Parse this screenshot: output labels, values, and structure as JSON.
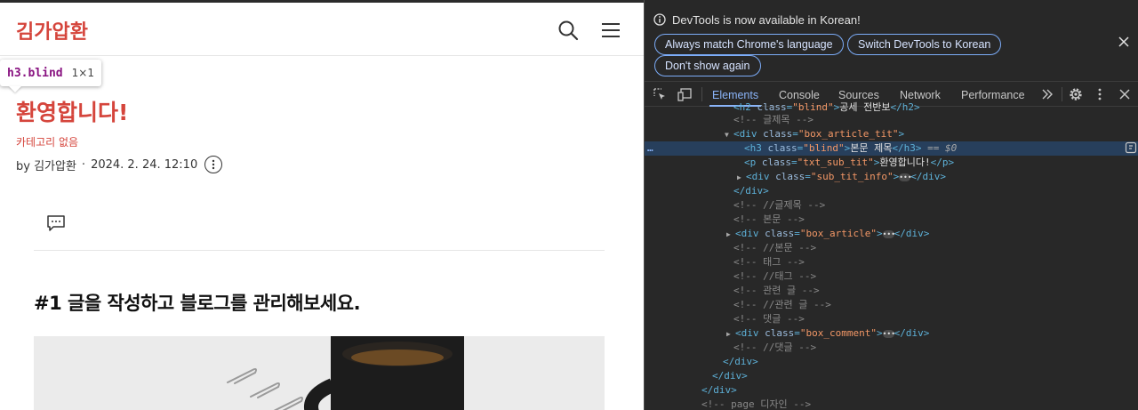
{
  "blog": {
    "site_title": "김가압환",
    "tooltip": {
      "selector": "h3.blind",
      "size": "1×1"
    },
    "post_title": "환영합니다!",
    "category": "카테고리 없음",
    "meta": {
      "author": "by 김가압환",
      "separator": "·",
      "date": "2024. 2. 24. 12:10"
    },
    "article_heading": "#1 글을 작성하고 블로그를 관리해보세요.",
    "icons": {
      "search": "search-icon",
      "menu": "hamburger-menu-icon",
      "more": "more-options-icon",
      "comment": "comment-icon"
    }
  },
  "devtools": {
    "infobar": {
      "message": "DevTools is now available in Korean!",
      "btn_match": "Always match Chrome's language",
      "btn_switch": "Switch DevTools to Korean",
      "btn_dont_show": "Don't show again"
    },
    "tabs": [
      "Elements",
      "Console",
      "Sources",
      "Network",
      "Performance"
    ],
    "active_tab": "Elements",
    "selected_marker": "== $0",
    "row_dots": "…",
    "dom": {
      "l0": {
        "tag_open": "<h2 ",
        "attr": "class",
        "eq": "=",
        "val": "\"blind\"",
        "close": ">",
        "text": "공세 전반보",
        "end": "</h2>"
      },
      "l1": "<!-- 글제목 -->",
      "l2": {
        "tag": "<div ",
        "attr": "class",
        "val": "\"box_article_tit\"",
        "close": ">"
      },
      "l3": {
        "tag": "<h3 ",
        "attr": "class",
        "val": "\"blind\"",
        "close": ">",
        "text": "본문 제목",
        "end": "</h3>"
      },
      "l4": {
        "tag": "<p ",
        "attr": "class",
        "val": "\"txt_sub_tit\"",
        "close": ">",
        "text": "환영합니다!",
        "end": "</p>"
      },
      "l5": {
        "tag": "<div ",
        "attr": "class",
        "val": "\"sub_tit_info\"",
        "close": ">",
        "end": "</div>"
      },
      "l6": "</div>",
      "l7": "<!-- //글제목 -->",
      "l8": "<!-- 본문 -->",
      "l9": {
        "tag": "<div ",
        "attr": "class",
        "val": "\"box_article\"",
        "close": ">",
        "end": "</div>"
      },
      "l10": "<!-- //본문 -->",
      "l11": "<!-- 태그 -->",
      "l12": "<!-- //태그 -->",
      "l13": "<!-- 관련 글 -->",
      "l14": "<!-- //관련 글 -->",
      "l15": "<!-- 댓글 -->",
      "l16": {
        "tag": "<div ",
        "attr": "class",
        "val": "\"box_comment\"",
        "close": ">",
        "end": "</div>"
      },
      "l17": "<!-- //댓글 -->",
      "l18": "</div>",
      "l19": "</div>",
      "l20": "</div>",
      "l21": "<!-- page 디자인 -->"
    }
  },
  "colors": {
    "brand": "#d5453c",
    "devtools_bg": "#282828",
    "selected_row": "#273f5c",
    "accent": "#8ab4f8"
  }
}
